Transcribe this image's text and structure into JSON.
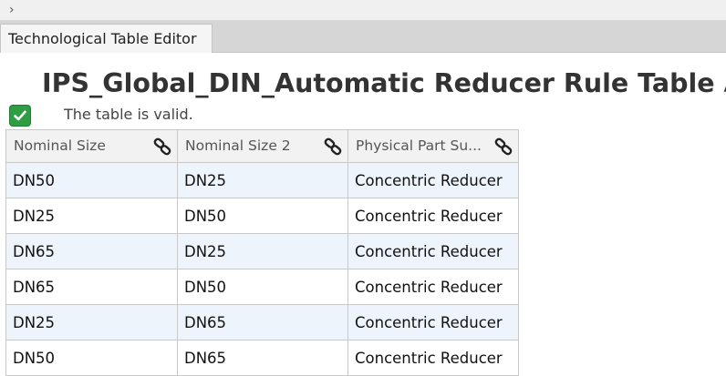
{
  "window": {
    "tab_label": "Technological Table Editor"
  },
  "editor": {
    "title": "IPS_Global_DIN_Automatic Reducer Rule Table A",
    "status_text": "The table is valid.",
    "status_icon": "checkmark-icon",
    "accent_color": "#2e9d44"
  },
  "table": {
    "columns": [
      {
        "label": "Nominal Size",
        "icon": "link-icon"
      },
      {
        "label": "Nominal Size 2",
        "icon": "link-icon"
      },
      {
        "label": "Physical Part Su...",
        "icon": "link-icon"
      }
    ],
    "rows": [
      [
        "DN50",
        "DN25",
        "Concentric Reducer"
      ],
      [
        "DN25",
        "DN50",
        "Concentric Reducer"
      ],
      [
        "DN65",
        "DN25",
        "Concentric Reducer"
      ],
      [
        "DN65",
        "DN50",
        "Concentric Reducer"
      ],
      [
        "DN25",
        "DN65",
        "Concentric Reducer"
      ],
      [
        "DN50",
        "DN65",
        "Concentric Reducer"
      ]
    ]
  }
}
